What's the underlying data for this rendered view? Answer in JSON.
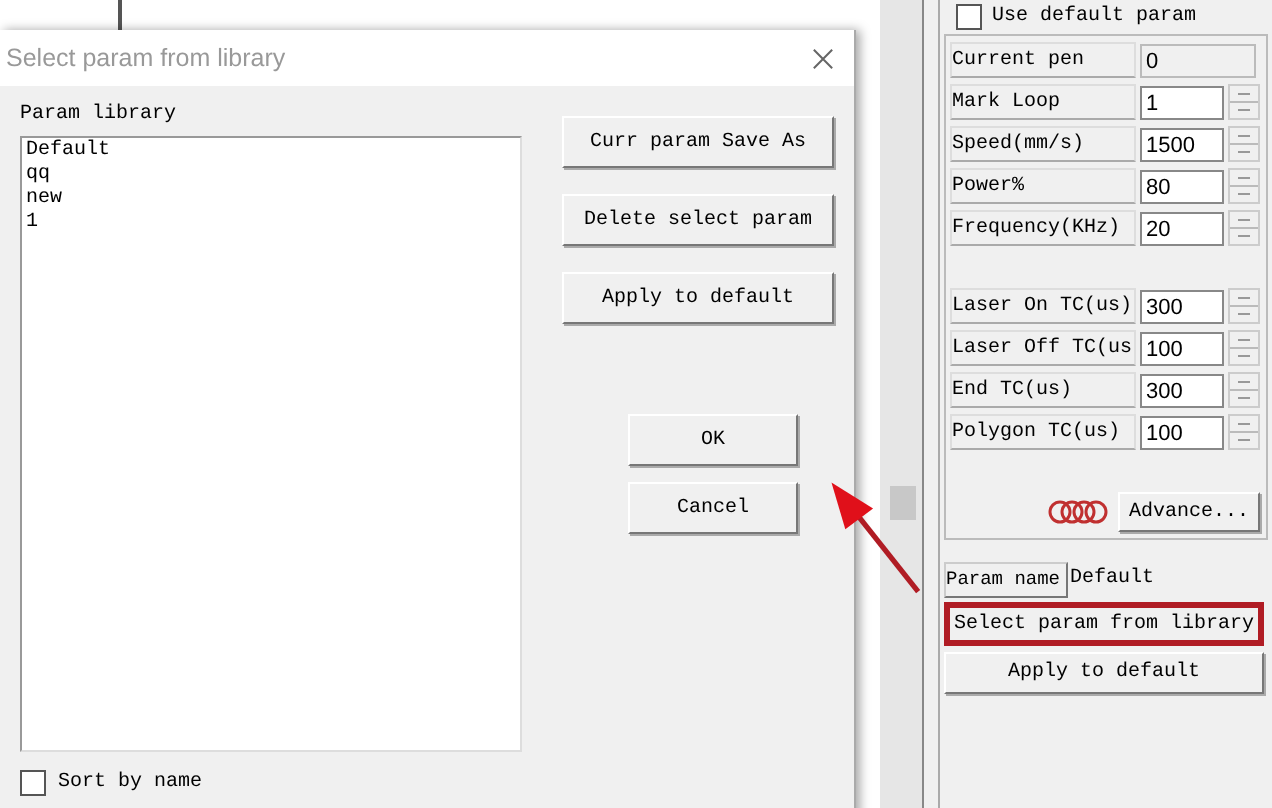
{
  "dialog": {
    "title": "Select param from library",
    "library_label": "Param library",
    "library_items": [
      {
        "label": "Default",
        "selected": false
      },
      {
        "label": "qq",
        "selected": false
      },
      {
        "label": "new",
        "selected": false
      },
      {
        "label": "1",
        "selected": false
      }
    ],
    "side_buttons": [
      "Curr param Save As",
      "Delete select param",
      "Apply to default"
    ],
    "ok_label": "OK",
    "cancel_label": "Cancel",
    "sort_by_name": {
      "label": "Sort by name",
      "checked": false
    }
  },
  "pen_panel": {
    "use_default": {
      "label": "Use default param",
      "checked": false
    },
    "param_groups": [
      [
        {
          "label": "Current pen",
          "value": "0",
          "kind": "readonly"
        },
        {
          "label": "Mark Loop",
          "value": "1",
          "kind": "spin"
        },
        {
          "label": "Speed(mm/s)",
          "value": "1500",
          "kind": "spin"
        },
        {
          "label": "Power%",
          "value": "80",
          "kind": "spin"
        },
        {
          "label": "Frequency(KHz)",
          "value": "20",
          "kind": "spin"
        }
      ],
      [
        {
          "label": "Laser On TC(us)",
          "value": "300",
          "kind": "spin"
        },
        {
          "label": "Laser Off TC(us",
          "value": "100",
          "kind": "spin"
        },
        {
          "label": "End TC(us)",
          "value": "300",
          "kind": "spin"
        },
        {
          "label": "Polygon TC(us)",
          "value": "100",
          "kind": "spin"
        }
      ]
    ],
    "advance_label": "Advance...",
    "param_name_label": "Param name",
    "param_name_value": "Default",
    "select_button": {
      "label": "Select param from library",
      "highlighted": true
    },
    "apply_label": "Apply to default"
  }
}
